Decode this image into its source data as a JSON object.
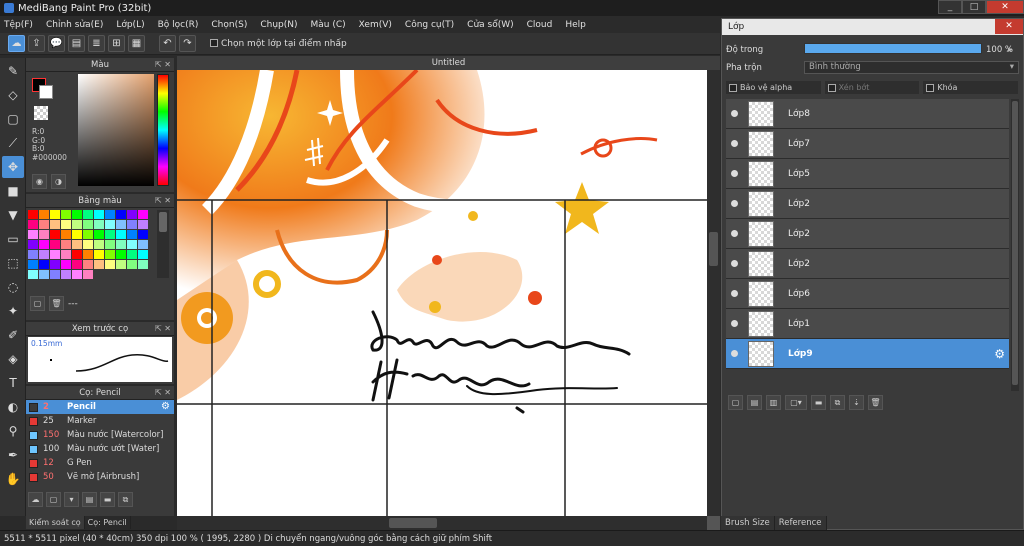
{
  "window": {
    "title": "MediBang Paint Pro (32bit)",
    "minimize": "_",
    "maximize": "□",
    "close": "✕"
  },
  "menu": [
    "Tệp(F)",
    "Chỉnh sửa(E)",
    "Lớp(L)",
    "Bộ lọc(R)",
    "Chọn(S)",
    "Chụp(N)",
    "Màu (C)",
    "Xem(V)",
    "Công cụ(T)",
    "Cửa sổ(W)",
    "Cloud",
    "Help"
  ],
  "toolbar": {
    "select_one_layer": "Chọn một lớp tại điểm nhấp"
  },
  "color_panel": {
    "title": "Màu",
    "r": "R:0",
    "g": "G:0",
    "b": "B:0",
    "hex": "#000000"
  },
  "palette_panel": {
    "title": "Bảng màu",
    "footer": "---"
  },
  "preview_panel": {
    "title": "Xem trước cọ",
    "size": "0.15mm"
  },
  "brush_panel": {
    "title": "Cọ: Pencil",
    "items": [
      {
        "size": "2",
        "name": "Pencil",
        "color": "#3a3a3a",
        "red": true
      },
      {
        "size": "25",
        "name": "Marker",
        "color": "#e53935",
        "red": false
      },
      {
        "size": "150",
        "name": "Màu nước [Watercolor]",
        "color": "#6ec6ff",
        "red": true
      },
      {
        "size": "100",
        "name": "Màu nước ướt [Water]",
        "color": "#6ec6ff",
        "red": false
      },
      {
        "size": "12",
        "name": "G Pen",
        "color": "#e53935",
        "red": true
      },
      {
        "size": "50",
        "name": "Vẽ mờ [Airbrush]",
        "color": "#e53935",
        "red": true
      }
    ]
  },
  "left_tabs": [
    "Kiểm soát cọ",
    "Cọ: Pencil"
  ],
  "canvas": {
    "doc_title": "Untitled"
  },
  "status": {
    "text": "5511 * 5511 pixel  (40 * 40cm)  350 dpi  100 %  ( 1995, 2280 )  Di chuyển ngang/vuông góc bằng cách giữ phím Shift"
  },
  "layer_window": {
    "title": "Lớp",
    "opacity_label": "Độ trong",
    "opacity_value": "100 %",
    "opacity": 1.0,
    "blend_label": "Pha trộn",
    "blend_value": "Bình thường",
    "protect_alpha": "Bảo vệ alpha",
    "clipping": "Xén bớt",
    "lock": "Khóa",
    "layers": [
      "Lớp8",
      "Lớp7",
      "Lớp5",
      "Lớp2",
      "Lớp2",
      "Lớp2",
      "Lớp6",
      "Lớp1",
      "Lớp9"
    ],
    "selected": "Lớp9"
  },
  "right_tabs": [
    "Brush Size",
    "Reference"
  ]
}
